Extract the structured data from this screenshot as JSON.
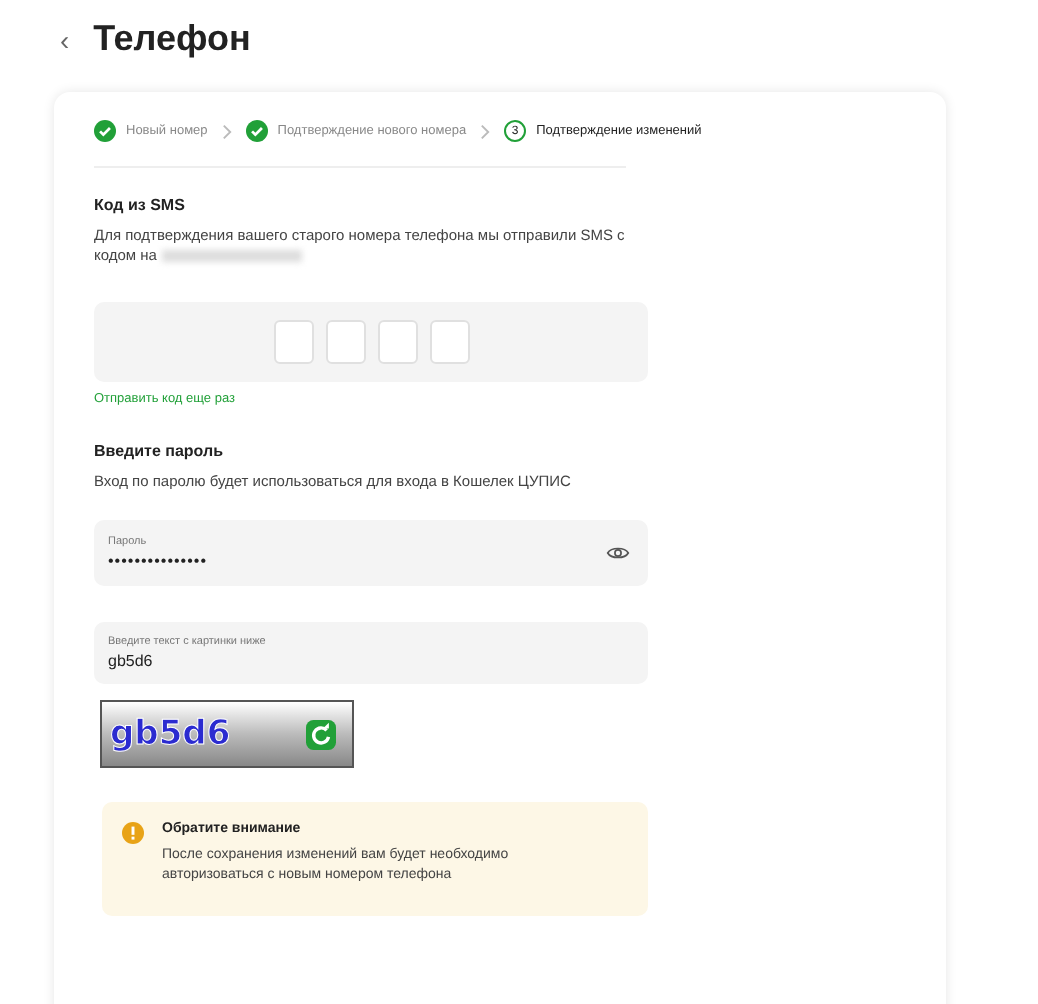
{
  "header": {
    "back": "‹",
    "title": "Телефон"
  },
  "steps": [
    {
      "label": "Новый номер",
      "done": true,
      "selected": false
    },
    {
      "label": "Подтверждение нового номера",
      "done": true,
      "selected": false
    },
    {
      "label": "Подтверждение изменений",
      "done": false,
      "selected": true,
      "number": "3"
    }
  ],
  "sms": {
    "title": "Код из SMS",
    "description": "Для подтверждения вашего старого номера телефона мы отправили SMS с кодом на",
    "resend": "Отправить код еще раз"
  },
  "password": {
    "title": "Введите пароль",
    "description": "Вход по паролю будет использоваться для входа в Кошелек ЦУПИС",
    "field_label": "Пароль",
    "value": "•••••••••••••••"
  },
  "captcha": {
    "field_label": "Введите текст с картинки ниже",
    "value": "gb5d6",
    "image_text": "gb5d6"
  },
  "notice": {
    "title": "Обратите внимание",
    "text": "После сохранения изменений вам будет необходимо авторизоваться с новым номером телефона"
  }
}
